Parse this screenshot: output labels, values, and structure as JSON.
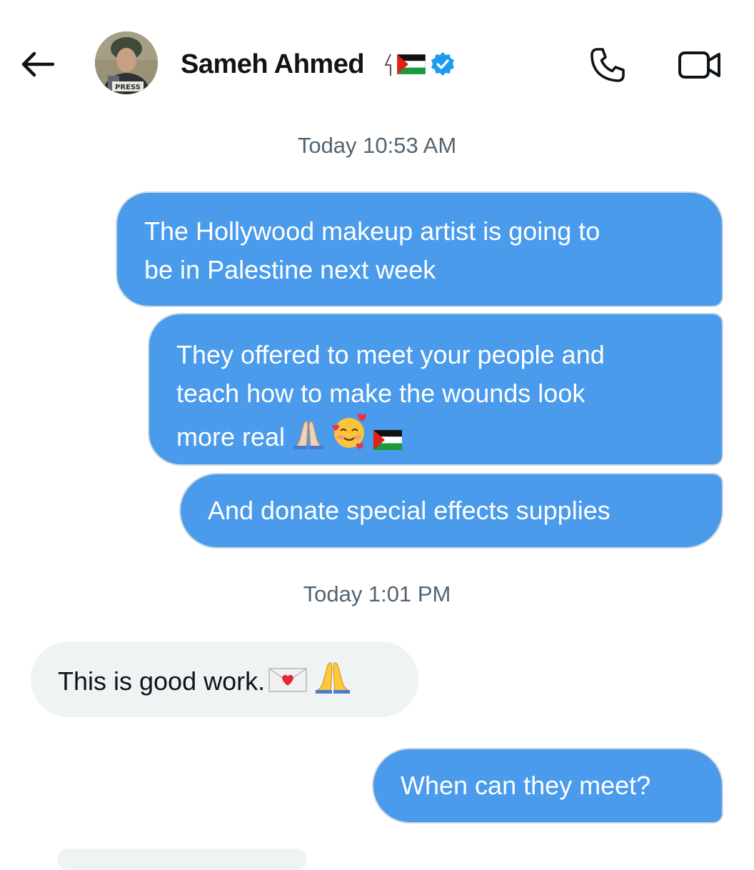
{
  "header": {
    "back_label": "back",
    "contact_name": "Sameh Ahmed",
    "avatar_badge_text": "PRESS",
    "verified": true,
    "name_emojis": [
      "palestine-flag-emoji",
      "verified-badge-icon"
    ]
  },
  "timestamps": [
    "Today 10:53 AM",
    "Today 1:01 PM"
  ],
  "messages": [
    {
      "direction": "outgoing",
      "line1": "The Hollywood makeup artist is going to",
      "line2": "be in Palestine next week"
    },
    {
      "direction": "outgoing",
      "line1": "They offered to meet your people and",
      "line2": "teach how to make the wounds look",
      "line3": "more real",
      "emojis": [
        "folded-hands-emoji",
        "smiling-face-with-hearts-emoji",
        "palestine-flag-emoji"
      ]
    },
    {
      "direction": "outgoing",
      "text": "And donate special effects supplies"
    },
    {
      "direction": "incoming",
      "text": "This is good work.",
      "emojis": [
        "love-letter-emoji",
        "folded-hands-emoji"
      ]
    },
    {
      "direction": "outgoing",
      "text": "When can they meet?"
    }
  ],
  "colors": {
    "outgoing_bubble": "#4a9beb",
    "incoming_bubble": "#eff3f4",
    "verified_blue": "#1d9bf0",
    "timestamp_text": "#536471"
  }
}
